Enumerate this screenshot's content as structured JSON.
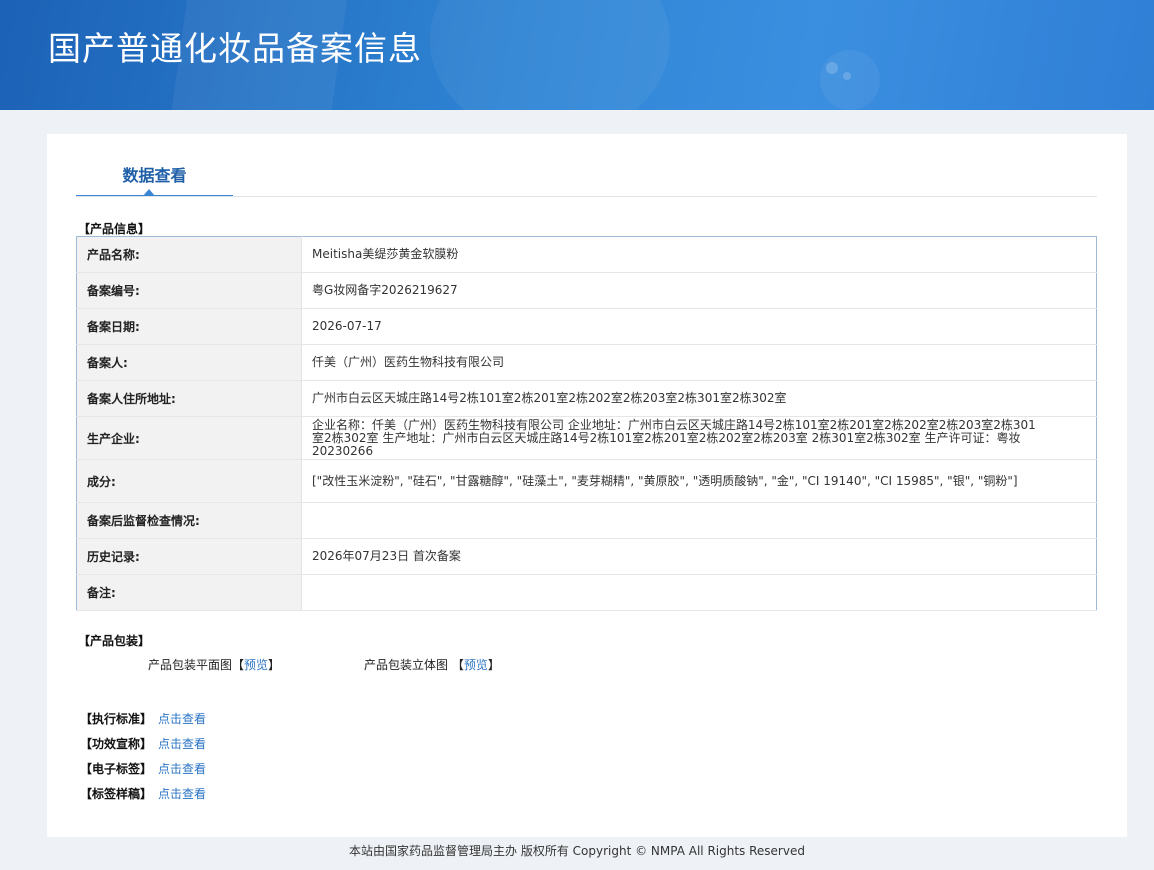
{
  "header": {
    "title": "国产普通化妆品备案信息"
  },
  "tab": {
    "label": "数据查看"
  },
  "product_info": {
    "section_label": "【产品信息】",
    "rows": [
      {
        "key": "产品名称:",
        "value": "Meitisha美缇莎黄金软膜粉"
      },
      {
        "key": "备案编号:",
        "value": "粤G妆网备字2026219627"
      },
      {
        "key": "备案日期:",
        "value": "2026-07-17"
      },
      {
        "key": "备案人:",
        "value": "仟美（广州）医药生物科技有限公司"
      },
      {
        "key": "备案人住所地址:",
        "value": "广州市白云区天城庄路14号2栋101室2栋201室2栋202室2栋203室2栋301室2栋302室"
      },
      {
        "key": "生产企业:",
        "value": "企业名称：仟美（广州）医药生物科技有限公司 企业地址：广州市白云区天城庄路14号2栋101室2栋201室2栋202室2栋203室2栋301室2栋302室 生产地址：广州市白云区天城庄路14号2栋101室2栋201室2栋202室2栋203室 2栋301室2栋302室 生产许可证：粤妆20230266"
      },
      {
        "key": "成分:",
        "value": "[\"改性玉米淀粉\", \"硅石\", \"甘露糖醇\", \"硅藻土\", \"麦芽糊精\", \"黄原胶\", \"透明质酸钠\", \"金\", \"CI 19140\", \"CI 15985\", \"银\", \"铜粉\"]"
      },
      {
        "key": "备案后监督检查情况:",
        "value": ""
      },
      {
        "key": "历史记录:",
        "value": "2026年07月23日 首次备案"
      },
      {
        "key": "备注:",
        "value": ""
      }
    ]
  },
  "packaging": {
    "section_label": "【产品包装】",
    "flat_label": "产品包装平面图",
    "solid_label": "产品包装立体图",
    "bracket_open": "【",
    "bracket_close": "】",
    "preview_link": "预览"
  },
  "links": [
    {
      "label": "【执行标准】",
      "link": "点击查看"
    },
    {
      "label": "【功效宣称】",
      "link": "点击查看"
    },
    {
      "label": "【电子标签】",
      "link": "点击查看"
    },
    {
      "label": "【标签样稿】",
      "link": "点击查看"
    }
  ],
  "footer": {
    "text": "本站由国家药品监督管理局主办 版权所有 Copyright © NMPA All Rights Reserved"
  }
}
